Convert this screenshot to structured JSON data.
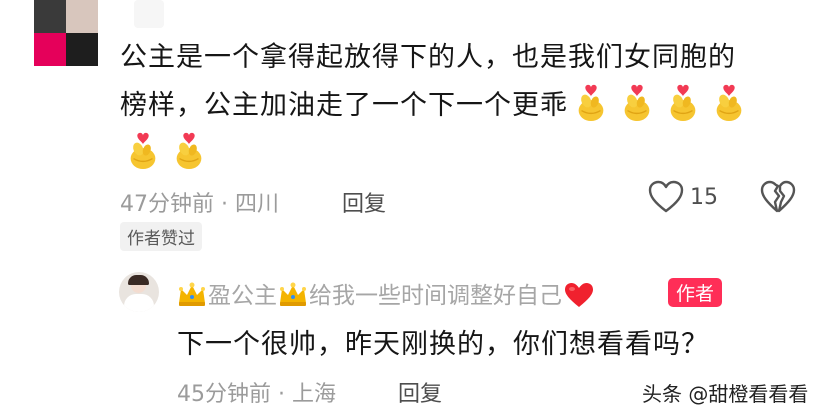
{
  "comment": {
    "line1": "公主是一个拿得起放得下的人，也是我们女同胞的",
    "line2": "榜样，公主加油走了一个下一个更乖",
    "time_location": "47分钟前 · 四川",
    "reply_label": "回复",
    "like_count": "15",
    "author_liked_label": "作者赞过",
    "emoji": "finger-heart-icon"
  },
  "reply": {
    "author_name": "盈公主",
    "author_suffix": "给我一些时间调整好自己",
    "author_badge": "作者",
    "text": "下一个很帅，昨天刚换的，你们想看看吗？",
    "time_location": "45分钟前 · 上海",
    "reply_label": "回复"
  },
  "watermark": "头条 @甜橙看看看",
  "colors": {
    "text_primary": "#161616",
    "meta": "#9b9b9b",
    "author_badge": "#ff2e57",
    "emoji_yellow": "#f6c530",
    "emoji_heart": "#f23a54"
  }
}
